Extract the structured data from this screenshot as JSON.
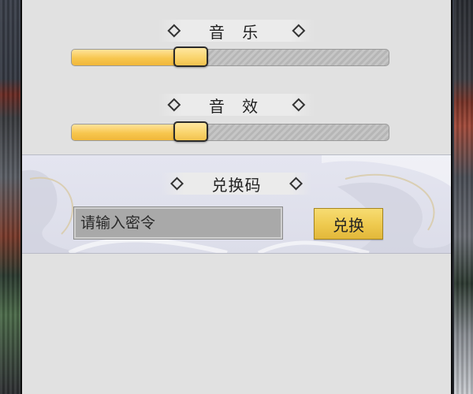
{
  "settings": {
    "music": {
      "label": "音 乐",
      "volume_fraction": 0.375
    },
    "sound_effects": {
      "label": "音 效",
      "volume_fraction": 0.375
    }
  },
  "redeem": {
    "title": "兑换码",
    "input_placeholder": "请输入密令",
    "input_value": "",
    "button_label": "兑换"
  },
  "colors": {
    "panel_bg": "#e1e1e1",
    "slider_fill": "#f7c64e",
    "button_gold": "#eec94e"
  },
  "icons": {
    "title_ornament": "diamond-icon"
  }
}
